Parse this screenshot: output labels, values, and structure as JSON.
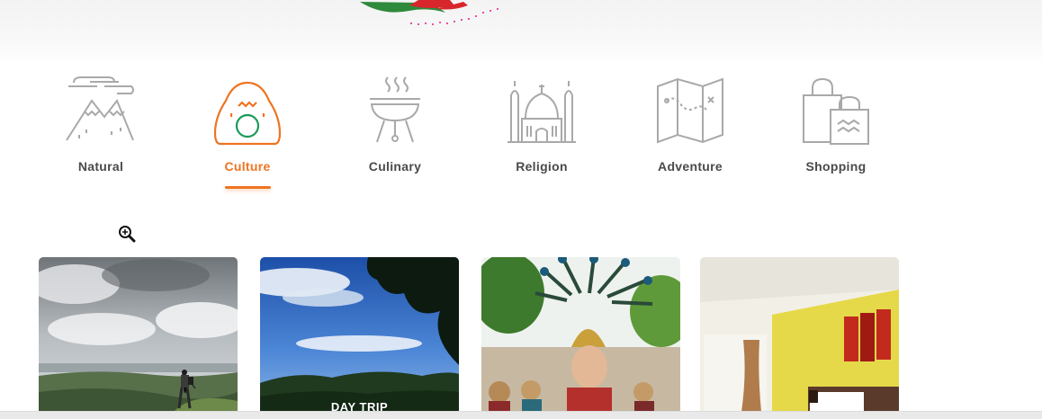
{
  "categories": [
    {
      "label": "Natural",
      "icon": "mountain-icon",
      "active": false
    },
    {
      "label": "Culture",
      "icon": "dome-icon",
      "active": true
    },
    {
      "label": "Culinary",
      "icon": "grill-icon",
      "active": false
    },
    {
      "label": "Religion",
      "icon": "mosque-icon",
      "active": false
    },
    {
      "label": "Adventure",
      "icon": "map-icon",
      "active": false
    },
    {
      "label": "Shopping",
      "icon": "shopping-bags-icon",
      "active": false
    }
  ],
  "cards": [
    {
      "image": "hiker-on-hill-photo",
      "label": ""
    },
    {
      "image": "forest-under-blue-sky-photo",
      "label": "DAY TRIP"
    },
    {
      "image": "peacock-dancer-photo",
      "label": ""
    },
    {
      "image": "hotel-room-photo",
      "label": ""
    }
  ],
  "colors": {
    "accent": "#ee7421",
    "icon_gray": "#a9a9a9",
    "label_gray": "#4a4a4a",
    "dome_green": "#1a9a5a"
  }
}
